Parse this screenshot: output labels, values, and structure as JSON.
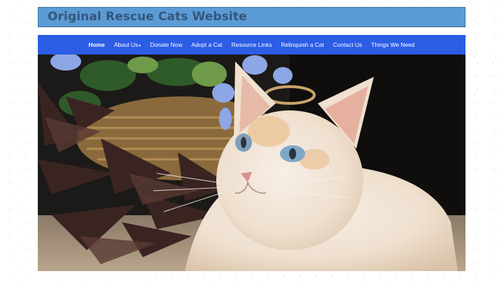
{
  "site": {
    "title": "Original Rescue Cats Website"
  },
  "nav": {
    "items": [
      {
        "label": "Home",
        "active": true
      },
      {
        "label": "About Us",
        "caret": "▾"
      },
      {
        "label": "Donate Now"
      },
      {
        "label": "Adopt a Cat"
      },
      {
        "label": "Resource Links"
      },
      {
        "label": "Relinquish a Cat"
      },
      {
        "label": "Contact Us"
      },
      {
        "label": "Things We Need"
      }
    ]
  },
  "colors": {
    "title_bar": "#5b9bd5",
    "title_text": "#35567a",
    "navbar": "#2c5de5"
  }
}
